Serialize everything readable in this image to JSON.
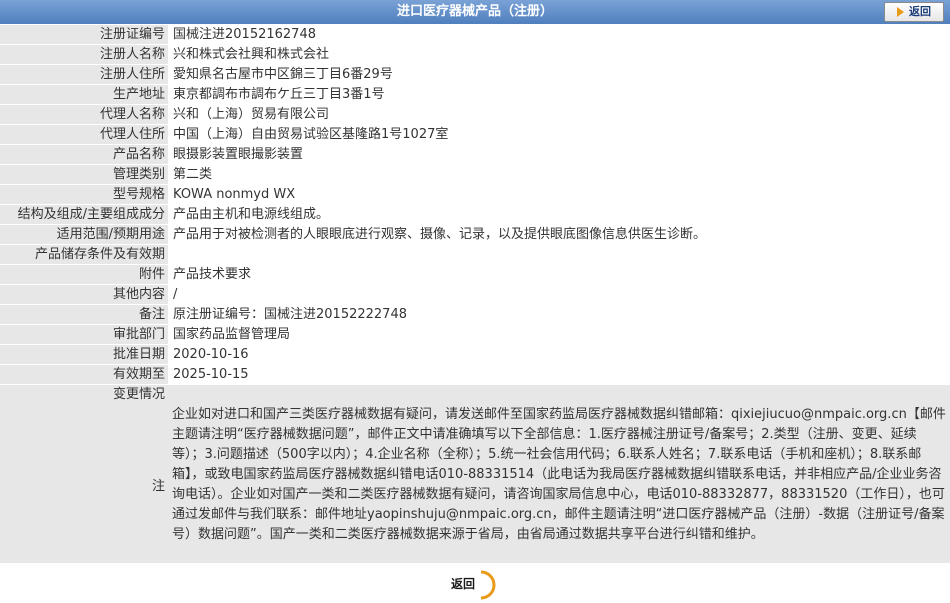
{
  "header": {
    "title": "进口医疗器械产品（注册）",
    "back_label": "返回"
  },
  "rows": [
    {
      "label": "注册证编号",
      "value": "国械注进20152162748"
    },
    {
      "label": "注册人名称",
      "value": "兴和株式会社興和株式会社"
    },
    {
      "label": "注册人住所",
      "value": "愛知県名古屋市中区錦三丁目6番29号"
    },
    {
      "label": "生产地址",
      "value": "東京都調布市調布ケ丘三丁目3番1号"
    },
    {
      "label": "代理人名称",
      "value": "兴和（上海）贸易有限公司"
    },
    {
      "label": "代理人住所",
      "value": "中国（上海）自由贸易试验区基隆路1号1027室"
    },
    {
      "label": "产品名称",
      "value": "眼摄影装置眼撮影装置"
    },
    {
      "label": "管理类别",
      "value": "第二类"
    },
    {
      "label": "型号规格",
      "value": "KOWA nonmyd WX"
    },
    {
      "label": "结构及组成/主要组成成分",
      "value": "产品由主机和电源线组成。"
    },
    {
      "label": "适用范围/预期用途",
      "value": "产品用于对被检测者的人眼眼底进行观察、摄像、记录，以及提供眼底图像信息供医生诊断。"
    },
    {
      "label": "产品储存条件及有效期",
      "value": ""
    },
    {
      "label": "附件",
      "value": "产品技术要求"
    },
    {
      "label": "其他内容",
      "value": "/"
    },
    {
      "label": "备注",
      "value": "原注册证编号：国械注进20152222748"
    },
    {
      "label": "审批部门",
      "value": "国家药品监督管理局"
    },
    {
      "label": "批准日期",
      "value": "2020-10-16"
    },
    {
      "label": "有效期至",
      "value": "2025-10-15"
    }
  ],
  "notice": {
    "change_label": "变更情况",
    "note_label": "注",
    "text": "企业如对进口和国产三类医疗器械数据有疑问，请发送邮件至国家药监局医疗器械数据纠错邮箱：qixiejiucuo@nmpaic.org.cn【邮件主题请注明“医疗器械数据问题”，邮件正文中请准确填写以下全部信息：1.医疗器械注册证号/备案号；2.类型（注册、变更、延续等）；3.问题描述（500字以内）；4.企业名称（全称）；5.统一社会信用代码；6.联系人姓名；7.联系电话（手机和座机）；8.联系邮箱】，或致电国家药监局医疗器械数据纠错电话010-88331514（此电话为我局医疗器械数据纠错联系电话，并非相应产品/企业业务咨询电话）。企业如对国产一类和二类医疗器械数据有疑问，请咨询国家局信息中心，电话010-88332877，88331520（工作日），也可通过发邮件与我们联系：邮件地址yaopinshuju@nmpaic.org.cn，邮件主题请注明“进口医疗器械产品（注册）-数据（注册证号/备案号）数据问题”。国产一类和二类医疗器械数据来源于省局，由省局通过数据共享平台进行纠错和维护。"
  },
  "footer": {
    "back_label": "返回"
  },
  "colors": {
    "header_bg": "#5b88c4",
    "label_bg": "#e7e7e7",
    "accent": "#e89a1a"
  }
}
